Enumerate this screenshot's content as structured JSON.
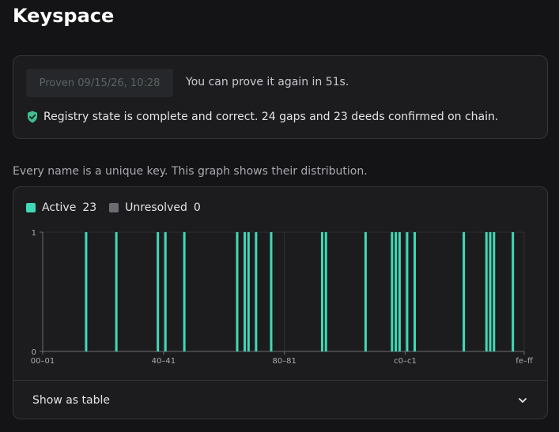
{
  "page": {
    "title": "Keyspace"
  },
  "proof": {
    "proven_label": "Proven 09/15/26, 10:28",
    "prove_again_text": "You can prove it again in 51s.",
    "status_icon": "shield-check-icon",
    "status_text": "Registry state is complete and correct. 24 gaps and 23 deeds confirmed on chain.",
    "status_color": "#3fbf8f"
  },
  "caption": "Every name is a unique key. This graph shows their distribution.",
  "legend": [
    {
      "label": "Active",
      "count": "23",
      "color": "#3fd9b5"
    },
    {
      "label": "Unresolved",
      "count": "0",
      "color": "#6b6b72"
    }
  ],
  "chart_data": {
    "type": "bar",
    "title": "",
    "xlabel": "",
    "ylabel": "",
    "x_domain": [
      0,
      255
    ],
    "ylim": [
      0,
      1
    ],
    "y_ticks": [
      "0",
      "1"
    ],
    "x_ticks": [
      {
        "label": "00–01",
        "bucket": 0
      },
      {
        "label": "40–41",
        "bucket": 64
      },
      {
        "label": "80–81",
        "bucket": 128
      },
      {
        "label": "c0–c1",
        "bucket": 192
      },
      {
        "label": "fe–ff",
        "bucket": 255
      }
    ],
    "grid": true,
    "series": [
      {
        "name": "Active",
        "color": "#3fd9b5",
        "x": [
          23,
          39,
          61,
          65,
          75,
          103,
          107,
          109,
          113,
          121,
          148,
          150,
          171,
          185,
          187,
          189,
          193,
          197,
          223,
          235,
          237,
          239,
          249
        ],
        "values": [
          1,
          1,
          1,
          1,
          1,
          1,
          1,
          1,
          1,
          1,
          1,
          1,
          1,
          1,
          1,
          1,
          1,
          1,
          1,
          1,
          1,
          1,
          1
        ]
      },
      {
        "name": "Unresolved",
        "color": "#6b6b72",
        "x": [],
        "values": []
      }
    ]
  },
  "table_toggle": {
    "label": "Show as table",
    "icon": "chevron-down-icon"
  }
}
